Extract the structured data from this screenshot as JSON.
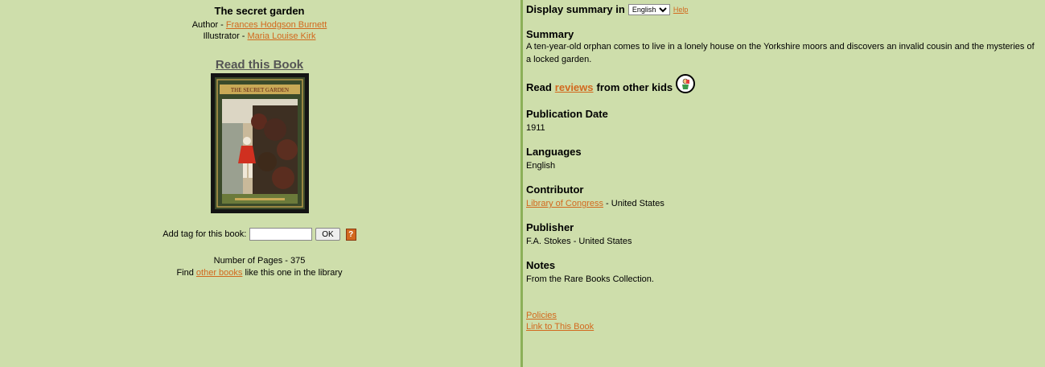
{
  "book": {
    "title": "The secret garden",
    "author_label": "Author - ",
    "author": "Frances Hodgson Burnett",
    "illustrator_label": "Illustrator - ",
    "illustrator": "Maria Louise Kirk",
    "read_link": "Read this Book",
    "cover_title": "THE SECRET GARDEN"
  },
  "tag": {
    "label": "Add tag for this book:",
    "value": "",
    "ok_label": "OK",
    "help_label": "?"
  },
  "pages": {
    "text": "Number of Pages - 375"
  },
  "find": {
    "prefix": "Find ",
    "link": "other books",
    "suffix": " like this one in the library"
  },
  "display": {
    "label": "Display summary in",
    "language": "English",
    "help": "Help"
  },
  "summary": {
    "heading": "Summary",
    "text": "A ten-year-old orphan comes to live in a lonely house on the Yorkshire moors and discovers an invalid cousin and the mysteries of a locked garden."
  },
  "reviews": {
    "prefix": "Read",
    "link": "reviews",
    "suffix": "from other kids"
  },
  "publication": {
    "heading": "Publication Date",
    "value": "1911"
  },
  "languages": {
    "heading": "Languages",
    "value": "English"
  },
  "contributor": {
    "heading": "Contributor",
    "link": "Library of Congress",
    "suffix": " - United States"
  },
  "publisher": {
    "heading": "Publisher",
    "value": "F.A. Stokes - United States"
  },
  "notes": {
    "heading": "Notes",
    "value": "From the Rare Books Collection."
  },
  "footer": {
    "policies": "Policies",
    "link_to_book": "Link to This Book"
  },
  "colors": {
    "background": "#cedeab",
    "link": "#d2691e",
    "divider": "#8cb058"
  }
}
